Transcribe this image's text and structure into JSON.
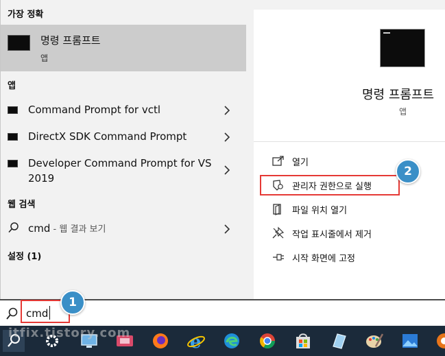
{
  "left": {
    "best_match_header": "가장 정확",
    "best_match": {
      "title": "명령 프롬프트",
      "subtitle": "앱"
    },
    "apps_header": "앱",
    "apps": [
      {
        "label": "Command Prompt for vctl"
      },
      {
        "label": "DirectX SDK Command Prompt"
      },
      {
        "label": "Developer Command Prompt for VS 2019"
      }
    ],
    "web_header": "웹 검색",
    "web_search": {
      "query": "cmd",
      "suffix": " - 웹 결과 보기"
    },
    "settings_header": "설정 (1)"
  },
  "detail": {
    "title": "명령 프롬프트",
    "subtitle": "앱",
    "actions": [
      {
        "label": "열기",
        "icon": "open-icon"
      },
      {
        "label": "관리자 권한으로 실행",
        "icon": "shield-icon"
      },
      {
        "label": "파일 위치 열기",
        "icon": "file-location-icon"
      },
      {
        "label": "작업 표시줄에서 제거",
        "icon": "unpin-icon"
      },
      {
        "label": "시작 화면에 고정",
        "icon": "pin-icon"
      }
    ]
  },
  "search": {
    "value": "cmd"
  },
  "callouts": {
    "step1": "1",
    "step2": "2"
  },
  "watermark": "itfix.tistory.com",
  "colors": {
    "highlight": "#e53935",
    "badge": "#3a8fc7",
    "taskbar": "#1b2a3a"
  },
  "taskbar_icons": [
    "search-icon",
    "gear-icon",
    "display-icon",
    "presentation-icon",
    "firefox-icon",
    "ie-icon",
    "edge-icon",
    "chrome-icon",
    "store-icon",
    "notes-icon",
    "paint-icon",
    "photos-icon",
    "office-icon"
  ]
}
